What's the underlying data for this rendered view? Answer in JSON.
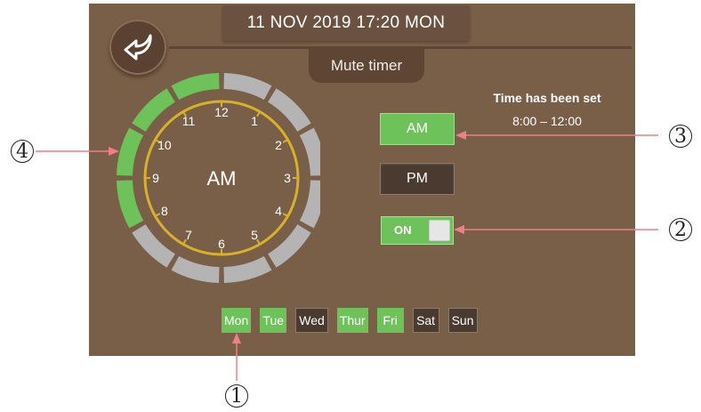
{
  "header": {
    "datetime": "11 NOV 2019 17:20 MON",
    "title": "Mute timer"
  },
  "dial": {
    "mode_label": "AM",
    "hour_labels": [
      "12",
      "1",
      "2",
      "3",
      "4",
      "5",
      "6",
      "7",
      "8",
      "9",
      "10",
      "11"
    ],
    "active_hours": [
      "8",
      "9",
      "10",
      "11"
    ]
  },
  "status": {
    "label": "Time has been set",
    "range": "8:00 – 12:00"
  },
  "buttons": {
    "am": "AM",
    "pm": "PM"
  },
  "toggle": {
    "label": "ON",
    "state": "on"
  },
  "days": [
    {
      "label": "Mon",
      "active": true
    },
    {
      "label": "Tue",
      "active": true
    },
    {
      "label": "Wed",
      "active": false
    },
    {
      "label": "Thur",
      "active": true
    },
    {
      "label": "Fri",
      "active": true
    },
    {
      "label": "Sat",
      "active": false
    },
    {
      "label": "Sun",
      "active": false
    }
  ],
  "callouts": {
    "c1": "1",
    "c2": "2",
    "c3": "3",
    "c4": "4"
  },
  "colors": {
    "screen_bg": "#7a5f48",
    "active_green": "#6ec25a",
    "inactive_gray": "#b4b4b4",
    "dial_ring": "#d8b12a",
    "callout_line": "#ee7f8a"
  },
  "icons": {
    "back": "back-arrow-icon"
  }
}
